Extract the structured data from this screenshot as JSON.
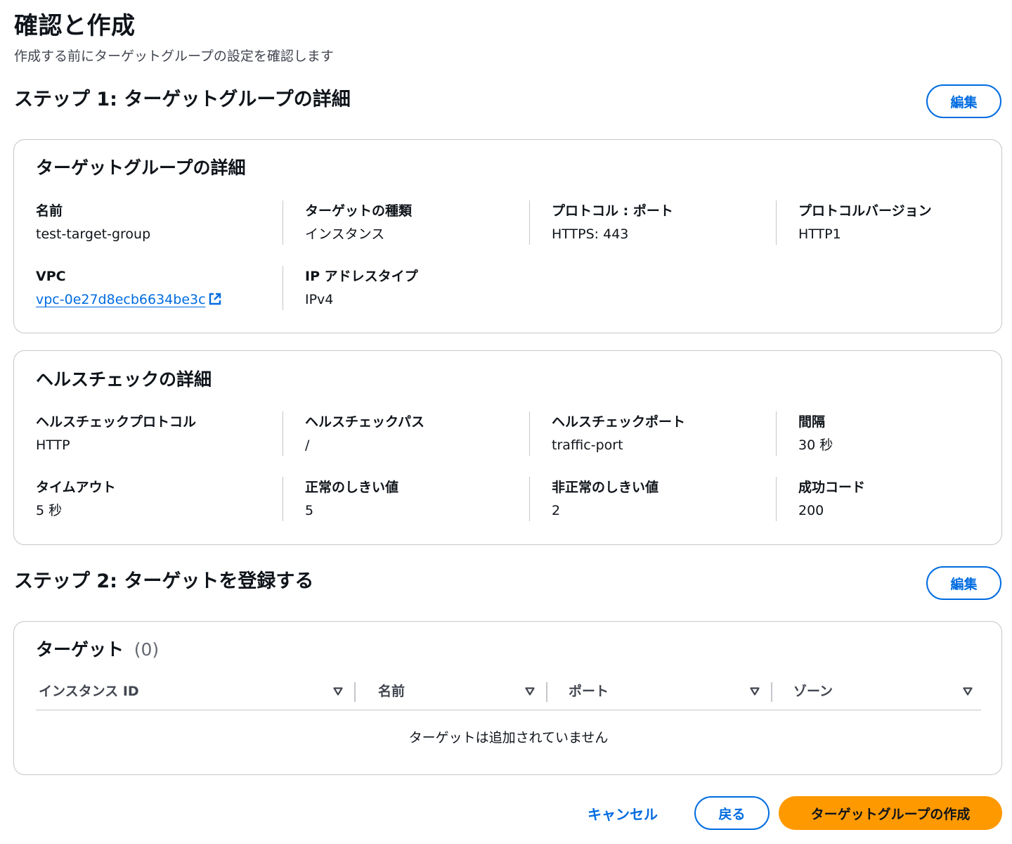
{
  "header": {
    "title": "確認と作成",
    "description": "作成する前にターゲットグループの設定を確認します"
  },
  "step1": {
    "title": "ステップ 1: ターゲットグループの詳細",
    "edit_label": "編集",
    "details_card": {
      "title": "ターゲットグループの詳細",
      "fields": [
        {
          "label": "名前",
          "value": "test-target-group"
        },
        {
          "label": "ターゲットの種類",
          "value": "インスタンス"
        },
        {
          "label": "プロトコル : ポート",
          "value": "HTTPS: 443"
        },
        {
          "label": "プロトコルバージョン",
          "value": "HTTP1"
        },
        {
          "label": "VPC",
          "value": "vpc-0e27d8ecb6634be3c"
        },
        {
          "label": "IP アドレスタイプ",
          "value": "IPv4"
        }
      ]
    },
    "health_card": {
      "title": "ヘルスチェックの詳細",
      "fields": [
        {
          "label": "ヘルスチェックプロトコル",
          "value": "HTTP"
        },
        {
          "label": "ヘルスチェックパス",
          "value": "/"
        },
        {
          "label": "ヘルスチェックポート",
          "value": "traffic-port"
        },
        {
          "label": "間隔",
          "value": "30 秒"
        },
        {
          "label": "タイムアウト",
          "value": "5 秒"
        },
        {
          "label": "正常のしきい値",
          "value": "5"
        },
        {
          "label": "非正常のしきい値",
          "value": "2"
        },
        {
          "label": "成功コード",
          "value": "200"
        }
      ]
    }
  },
  "step2": {
    "title": "ステップ 2: ターゲットを登録する",
    "edit_label": "編集",
    "targets_card": {
      "title": "ターゲット",
      "count": "(0)",
      "columns": [
        "インスタンス ID",
        "名前",
        "ポート",
        "ゾーン"
      ],
      "empty_message": "ターゲットは追加されていません"
    }
  },
  "footer": {
    "cancel_label": "キャンセル",
    "back_label": "戻る",
    "create_label": "ターゲットグループの作成"
  },
  "colors": {
    "link": "#006ce0",
    "primary_button": "#ff9900",
    "border": "#c6c6cd"
  },
  "icons": {
    "external_link": "external-link-icon",
    "sort": "sort-down-icon"
  }
}
